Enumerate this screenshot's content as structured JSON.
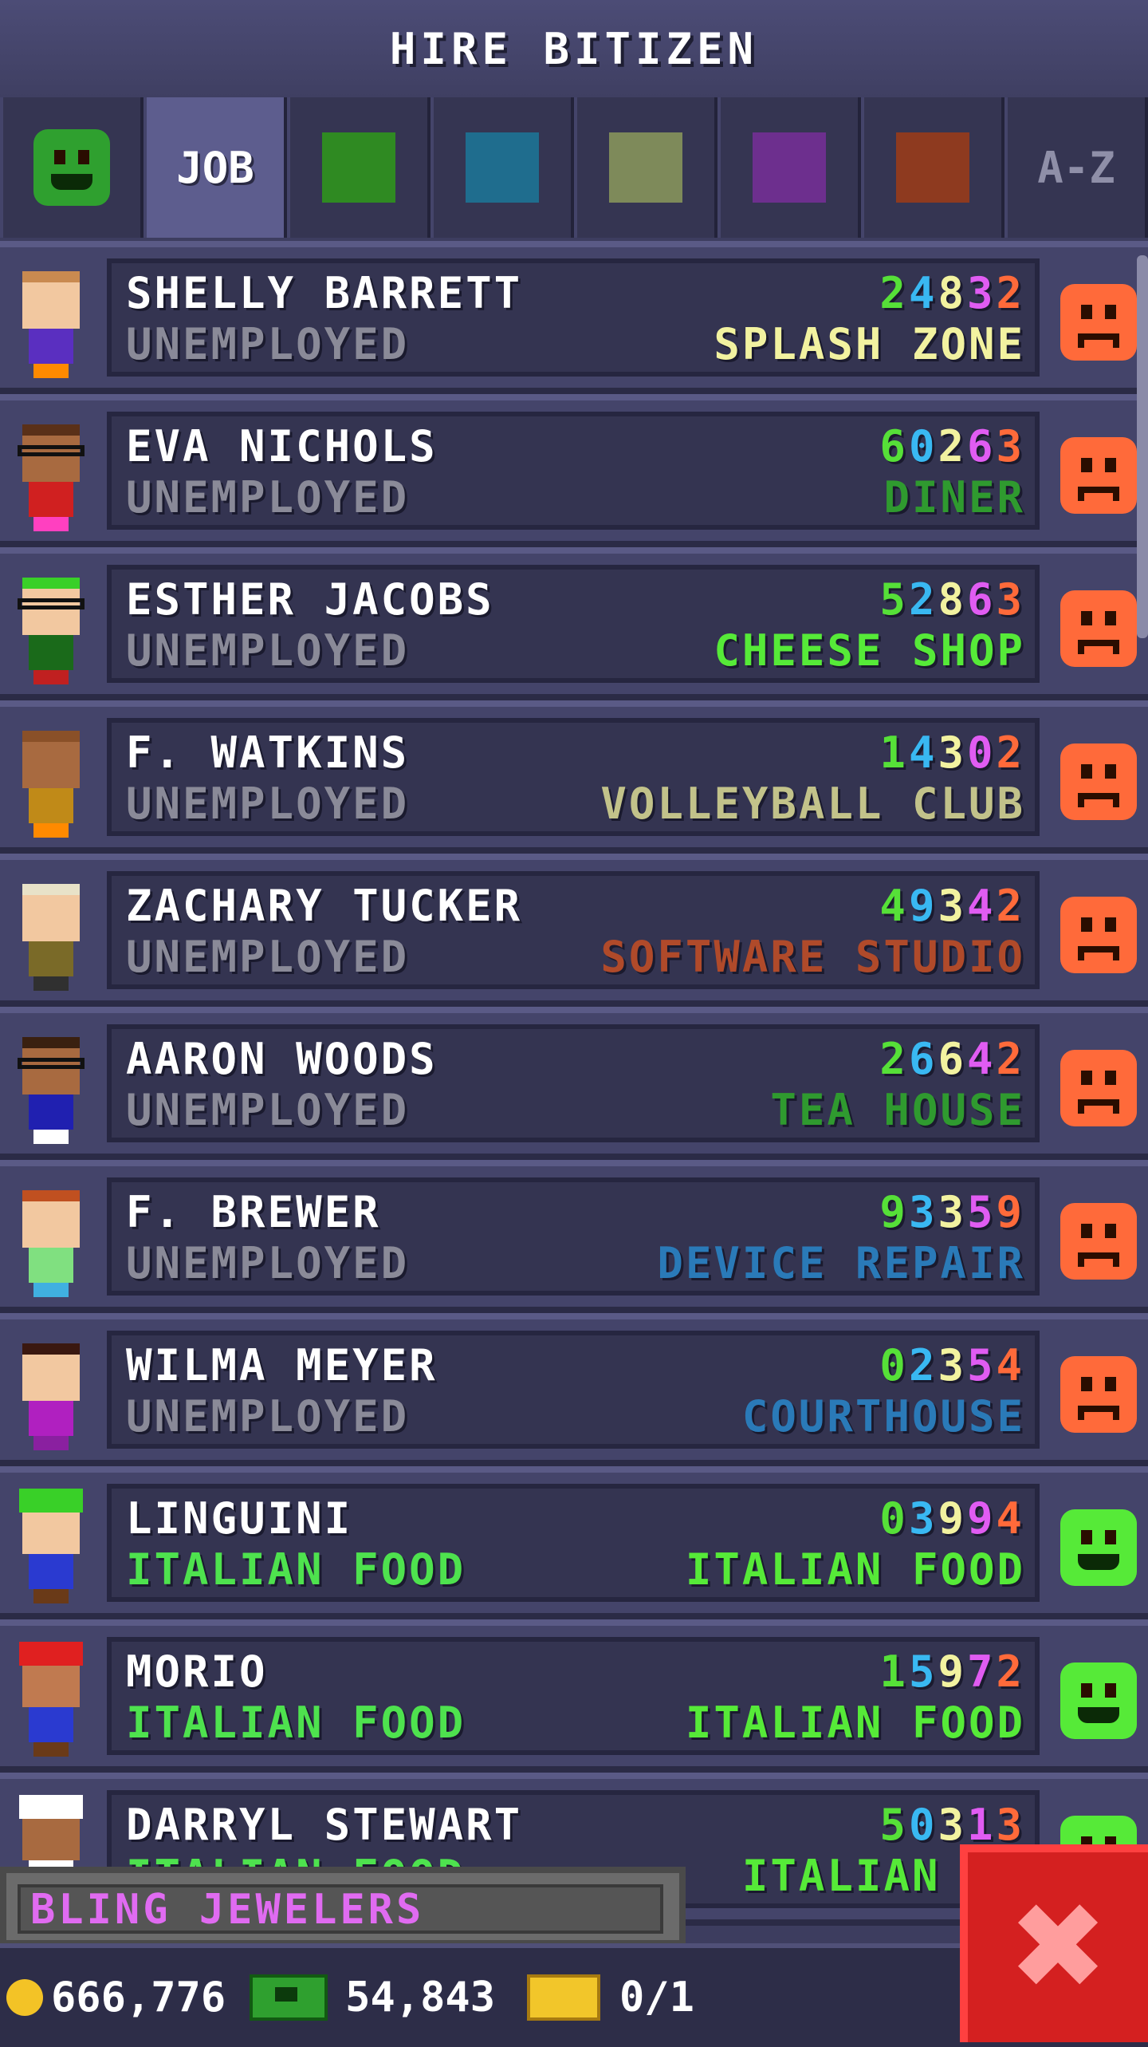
{
  "header": {
    "title": "HIRE BITIZEN"
  },
  "tabs": [
    {
      "type": "face",
      "icon": "happy-face-icon"
    },
    {
      "type": "text",
      "label": "JOB",
      "active": true
    },
    {
      "type": "swatch",
      "color": "#2f8a22",
      "icon": "food-category-swatch"
    },
    {
      "type": "swatch",
      "color": "#1f6d8e",
      "icon": "service-category-swatch"
    },
    {
      "type": "swatch",
      "color": "#7e8a5a",
      "icon": "recreation-category-swatch"
    },
    {
      "type": "swatch",
      "color": "#6d2f8e",
      "icon": "retail-category-swatch"
    },
    {
      "type": "swatch",
      "color": "#8e3a1f",
      "icon": "creative-category-swatch"
    },
    {
      "type": "text",
      "label": "A-Z"
    }
  ],
  "stat_colors": [
    "#56e038",
    "#39b8f2",
    "#f2f2a0",
    "#e05cf2",
    "#ff6a3a"
  ],
  "bitizens": [
    {
      "name": "SHELLY BARRETT",
      "status": "UNEMPLOYED",
      "stats": "24832",
      "dream_job": "SPLASH ZONE",
      "dream_color": "#f2f2a0",
      "mood": "unhappy",
      "skin": "#f2c8a0",
      "hair": "#c98a50",
      "shirt": "#5a2fc0",
      "pants": "#ff8a00"
    },
    {
      "name": "EVA NICHOLS",
      "status": "UNEMPLOYED",
      "stats": "60263",
      "dream_job": "DINER",
      "dream_color": "#2f9a2f",
      "mood": "unhappy",
      "skin": "#a86a40",
      "hair": "#5a3018",
      "shirt": "#d02020",
      "pants": "#ff40c0",
      "glasses": true
    },
    {
      "name": "ESTHER JACOBS",
      "status": "UNEMPLOYED",
      "stats": "52863",
      "dream_job": "CHEESE SHOP",
      "dream_color": "#56ea38",
      "mood": "unhappy",
      "skin": "#f2c8a0",
      "hair": "#39d028",
      "shirt": "#1a6a1a",
      "pants": "#c02020",
      "glasses": true
    },
    {
      "name": "F. WATKINS",
      "status": "UNEMPLOYED",
      "stats": "14302",
      "dream_job": "VOLLEYBALL CLUB",
      "dream_color": "#c2c28a",
      "mood": "unhappy",
      "skin": "#a86a40",
      "hair": "#8a5028",
      "shirt": "#c08a18",
      "pants": "#ff8a00"
    },
    {
      "name": "ZACHARY TUCKER",
      "status": "UNEMPLOYED",
      "stats": "49342",
      "dream_job": "SOFTWARE STUDIO",
      "dream_color": "#b04a2a",
      "mood": "unhappy",
      "skin": "#f2c8a0",
      "hair": "#e8e2c8",
      "shirt": "#7a6a28",
      "pants": "#303030"
    },
    {
      "name": "AARON WOODS",
      "status": "UNEMPLOYED",
      "stats": "26642",
      "dream_job": "TEA HOUSE",
      "dream_color": "#2f9a2f",
      "mood": "unhappy",
      "skin": "#a86a40",
      "hair": "#3a2010",
      "shirt": "#2020b0",
      "pants": "#ffffff",
      "glasses": true
    },
    {
      "name": "F. BREWER",
      "status": "UNEMPLOYED",
      "stats": "93359",
      "dream_job": "DEVICE REPAIR",
      "dream_color": "#2a7ab8",
      "mood": "unhappy",
      "skin": "#f2c8a0",
      "hair": "#c05020",
      "shirt": "#80e080",
      "pants": "#40b0e0"
    },
    {
      "name": "WILMA MEYER",
      "status": "UNEMPLOYED",
      "stats": "02354",
      "dream_job": "COURTHOUSE",
      "dream_color": "#2a7ab8",
      "mood": "unhappy",
      "skin": "#f2c8a0",
      "hair": "#3a1810",
      "shirt": "#b020c0",
      "pants": "#8a20a0"
    },
    {
      "name": "LINGUINI",
      "status": "ITALIAN FOOD",
      "status_good": true,
      "stats": "03994",
      "dream_job": "ITALIAN FOOD",
      "dream_color": "#56ea38",
      "mood": "happy",
      "skin": "#f2c8a0",
      "hair": "#39d028",
      "shirt": "#2a3ad0",
      "pants": "#6a3a18",
      "hat": "#39d028"
    },
    {
      "name": "MORIO",
      "status": "ITALIAN FOOD",
      "status_good": true,
      "stats": "15972",
      "dream_job": "ITALIAN FOOD",
      "dream_color": "#56ea38",
      "mood": "happy",
      "skin": "#c07a50",
      "hair": "#5a3018",
      "shirt": "#2a3ad0",
      "pants": "#6a3a18",
      "hat": "#e02020"
    },
    {
      "name": "DARRYL STEWART",
      "status": "ITALIAN FOOD",
      "status_good": true,
      "stats": "50313",
      "dream_job": "ITALIAN FO",
      "dream_color": "#56ea38",
      "mood": "happy",
      "skin": "#a86a40",
      "hair": "#ffffff",
      "shirt": "#ffffff",
      "pants": "#303030",
      "hat": "#ffffff"
    }
  ],
  "floor_label": "BLING JEWELERS",
  "footer": {
    "coins": "666,776",
    "bux": "54,843",
    "tickets": "0/1"
  },
  "close_label": "✖"
}
